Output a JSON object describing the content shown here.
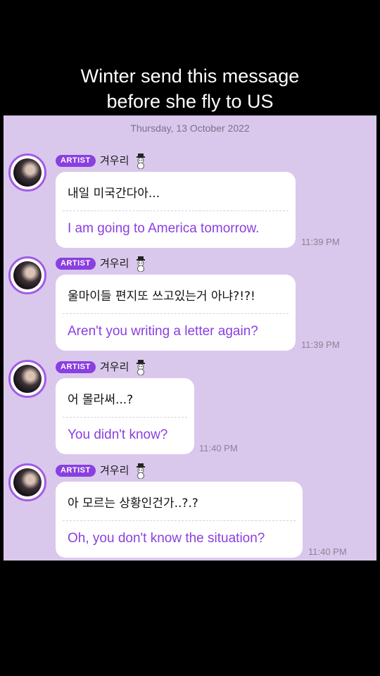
{
  "caption": {
    "line1": "Winter send this message",
    "line2": "before she fly to US"
  },
  "chat": {
    "date": "Thursday, 13 October 2022",
    "badge": "ARTIST",
    "sender": "겨우리",
    "sender_emoji": "snowman-icon",
    "messages": [
      {
        "original": "내일 미국간다아...",
        "translation": "I am going to America tomorrow.",
        "time": "11:39 PM"
      },
      {
        "original": "울마이들 편지또 쓰고있는거 아냐?!?!",
        "translation": "Aren't you writing a letter again?",
        "time": "11:39 PM"
      },
      {
        "original": "어 몰라써...?",
        "translation": "You didn't know?",
        "time": "11:40 PM"
      },
      {
        "original": "아 모르는 상황인건가..?.?",
        "translation": "Oh, you don't know the situation?",
        "time": "11:40 PM"
      }
    ]
  },
  "colors": {
    "chat_background": "#d9c8ec",
    "accent": "#8a3fe0",
    "page_background": "#000000"
  }
}
